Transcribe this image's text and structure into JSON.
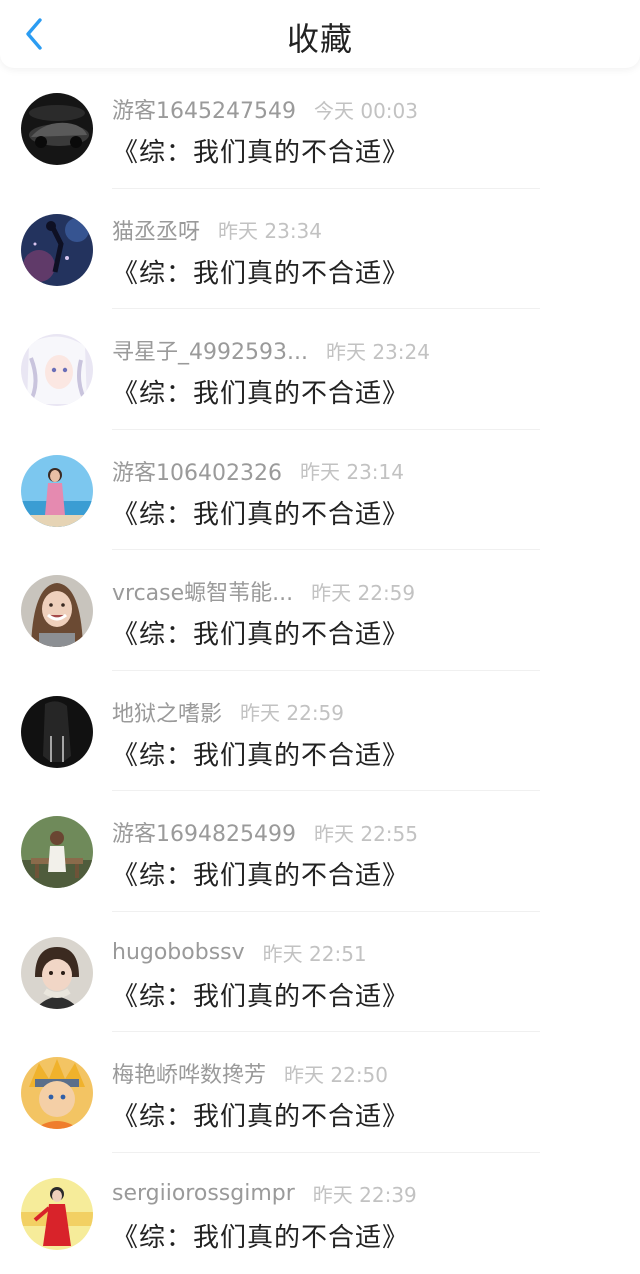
{
  "header": {
    "title": "收藏",
    "back_icon": "chevron-left-icon",
    "accent_color": "#2b9cf2"
  },
  "items": [
    {
      "user": "游客1645247549",
      "time": "今天 00:03",
      "book": "《综：我们真的不合适》",
      "avatar": "car"
    },
    {
      "user": "猫丞丞呀",
      "time": "昨天 23:34",
      "book": "《综：我们真的不合适》",
      "avatar": "night-figure"
    },
    {
      "user": "寻星子_4992593...",
      "time": "昨天 23:24",
      "book": "《综：我们真的不合适》",
      "avatar": "anime-girl"
    },
    {
      "user": "游客106402326",
      "time": "昨天 23:14",
      "book": "《综：我们真的不合适》",
      "avatar": "beach-girl"
    },
    {
      "user": "vrcase螈智苇能...",
      "time": "昨天 22:59",
      "book": "《综：我们真的不合适》",
      "avatar": "smiling-woman"
    },
    {
      "user": "地狱之嗜影",
      "time": "昨天 22:59",
      "book": "《综：我们真的不合适》",
      "avatar": "dark-horse"
    },
    {
      "user": "游客1694825499",
      "time": "昨天 22:55",
      "book": "《综：我们真的不合适》",
      "avatar": "bench-girl"
    },
    {
      "user": "hugobobssv",
      "time": "昨天 22:51",
      "book": "《综：我们真的不合适》",
      "avatar": "child"
    },
    {
      "user": "梅艳峤哗数搀芳",
      "time": "昨天 22:50",
      "book": "《综：我们真的不合适》",
      "avatar": "anime-ninja"
    },
    {
      "user": "sergiiorossgimpr",
      "time": "昨天 22:39",
      "book": "《综：我们真的不合适》",
      "avatar": "red-dress"
    }
  ]
}
